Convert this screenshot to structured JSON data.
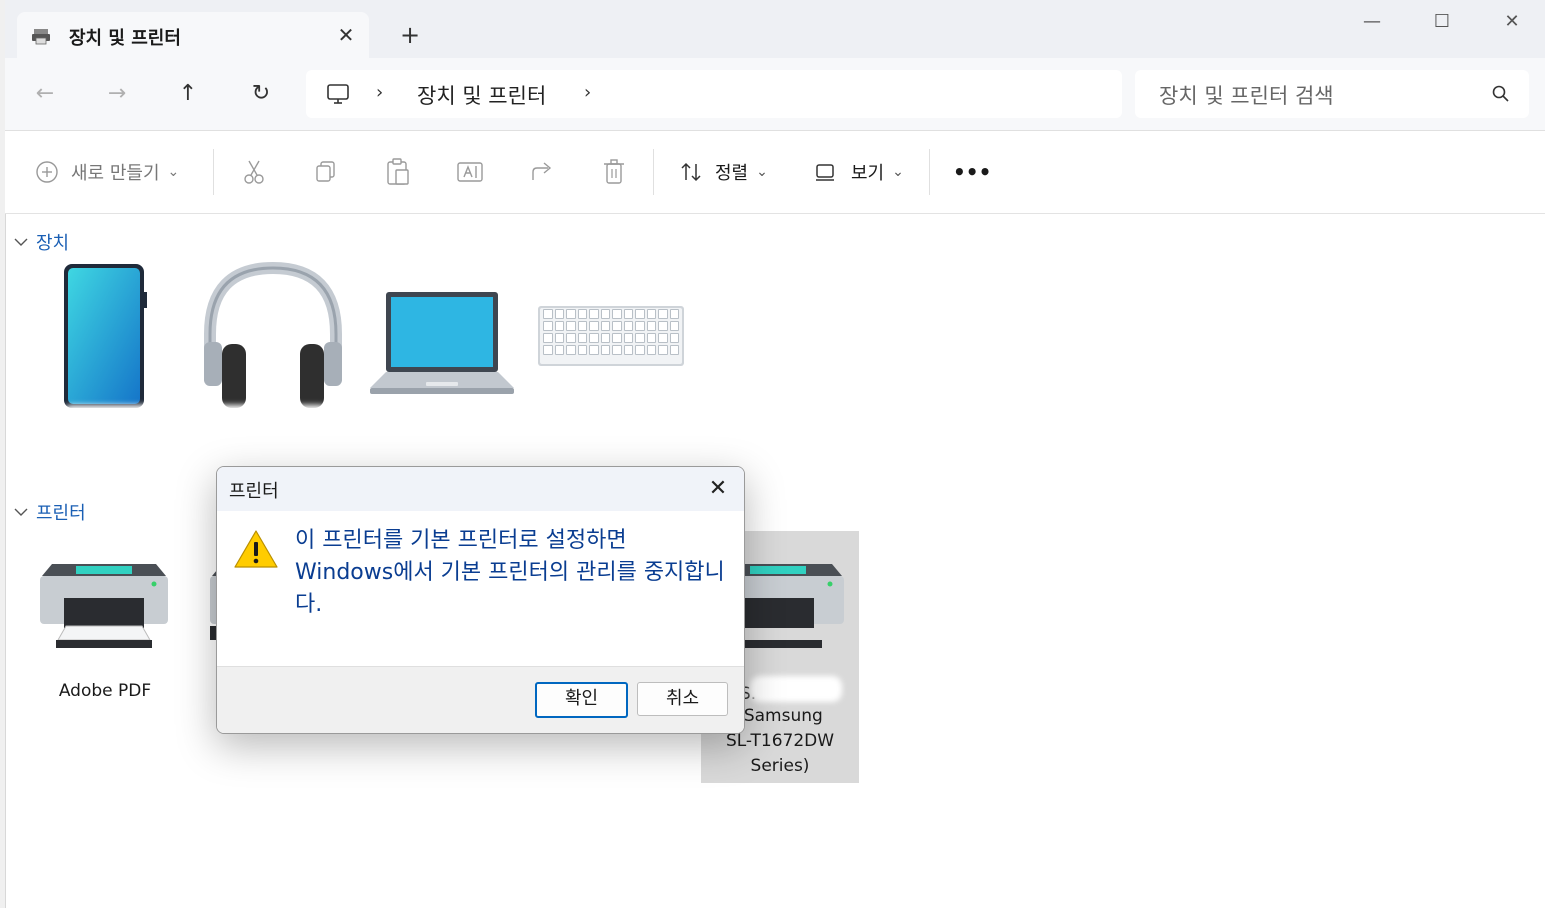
{
  "window": {
    "tab_title": "장치 및 프린터",
    "tab_close": "✕",
    "new_tab": "+",
    "minimize": "—",
    "maximize": "☐",
    "close": "✕"
  },
  "nav": {
    "back": "←",
    "forward": "→",
    "up": "↑",
    "refresh": "↻",
    "breadcrumb_sep1": "›",
    "breadcrumb_text": "장치 및 프린터",
    "breadcrumb_sep2": "›",
    "search_placeholder": "장치 및 프린터 검색"
  },
  "toolbar": {
    "new_label": "새로 만들기",
    "sort_label": "정렬",
    "view_label": "보기",
    "more": "•••",
    "chevron": "⌄"
  },
  "sections": {
    "devices": "장치",
    "printers": "프린터"
  },
  "printers": {
    "adobe_label": "Adobe PDF",
    "samsung_label_line1": "(Samsung",
    "samsung_label_line2": "SL-T1672DW",
    "samsung_label_line3": "Series)",
    "samsung_prefix": "S."
  },
  "dialog": {
    "title": "프린터",
    "close": "✕",
    "message": "이 프린터를 기본 프린터로 설정하면 Windows에서 기본 프린터의 관리를 중지합니다.",
    "ok_label": "확인",
    "cancel_label": "취소"
  },
  "colors": {
    "accent": "#0067c0",
    "section_text": "#1a5fb4",
    "dialog_message": "#0a3d91"
  }
}
